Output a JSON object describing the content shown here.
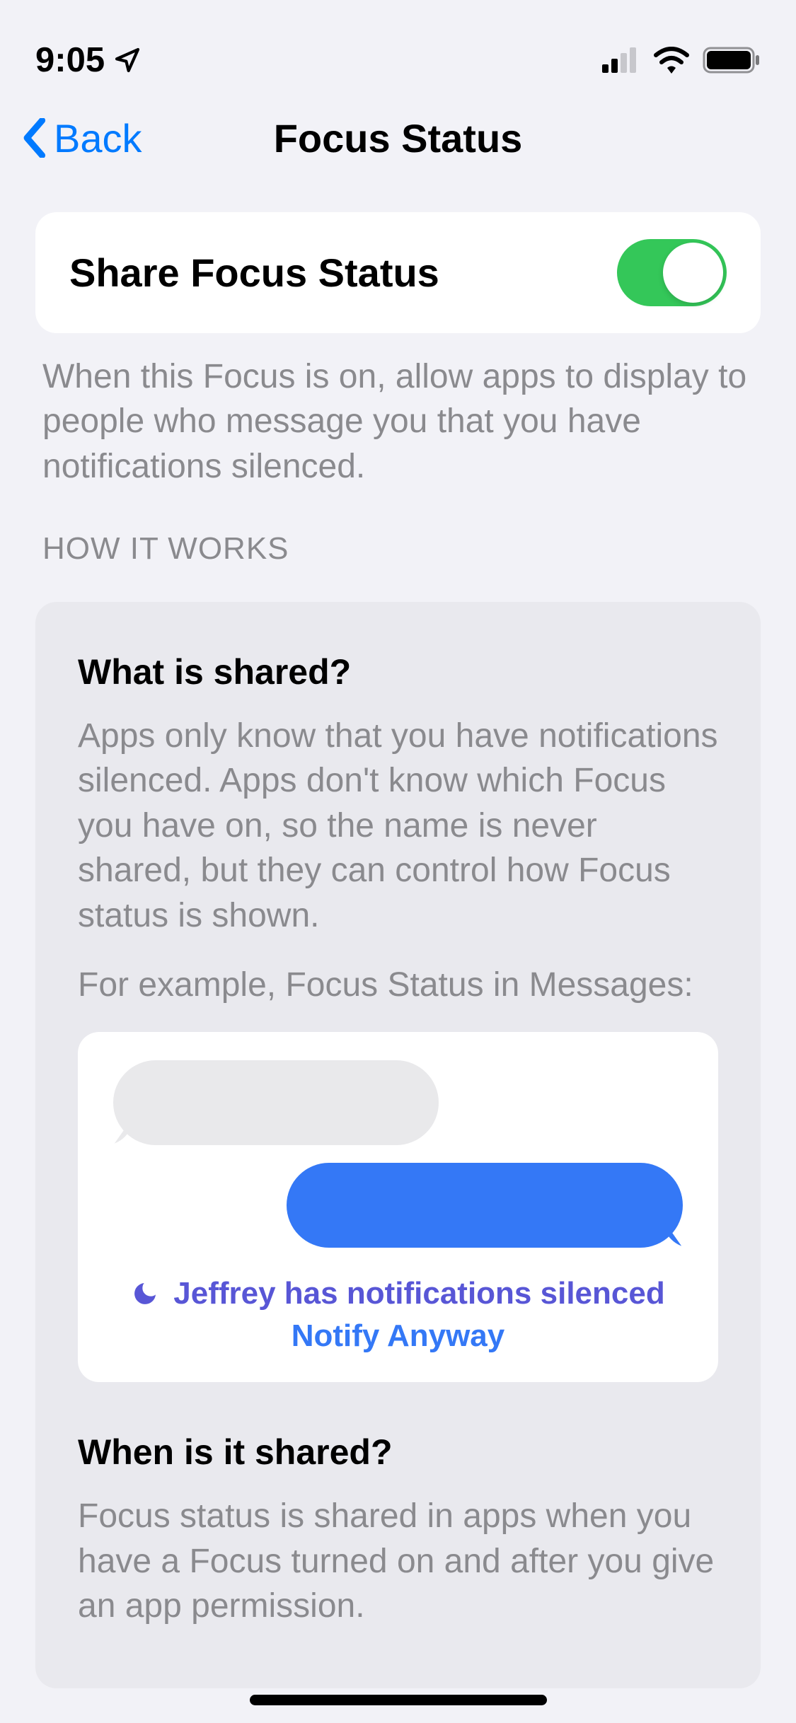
{
  "status_bar": {
    "time": "9:05"
  },
  "nav": {
    "back_label": "Back",
    "title": "Focus Status"
  },
  "toggle": {
    "label": "Share Focus Status",
    "on": true
  },
  "description": "When this Focus is on, allow apps to display to people who message you that you have notifications silenced.",
  "section_header": "HOW IT WORKS",
  "info_sections": [
    {
      "title": "What is shared?",
      "body": "Apps only know that you have notifications silenced. Apps don't know which Focus you have on, so the name is never shared, but they can control how Focus status is shown.",
      "example_label": "For example, Focus Status in Messages:"
    },
    {
      "title": "When is it shared?",
      "body": "Focus status is shared in apps when you have a Focus turned on and after you give an app permission."
    }
  ],
  "messages_preview": {
    "silenced_text": "Jeffrey has notifications silenced",
    "notify_label": "Notify Anyway"
  }
}
